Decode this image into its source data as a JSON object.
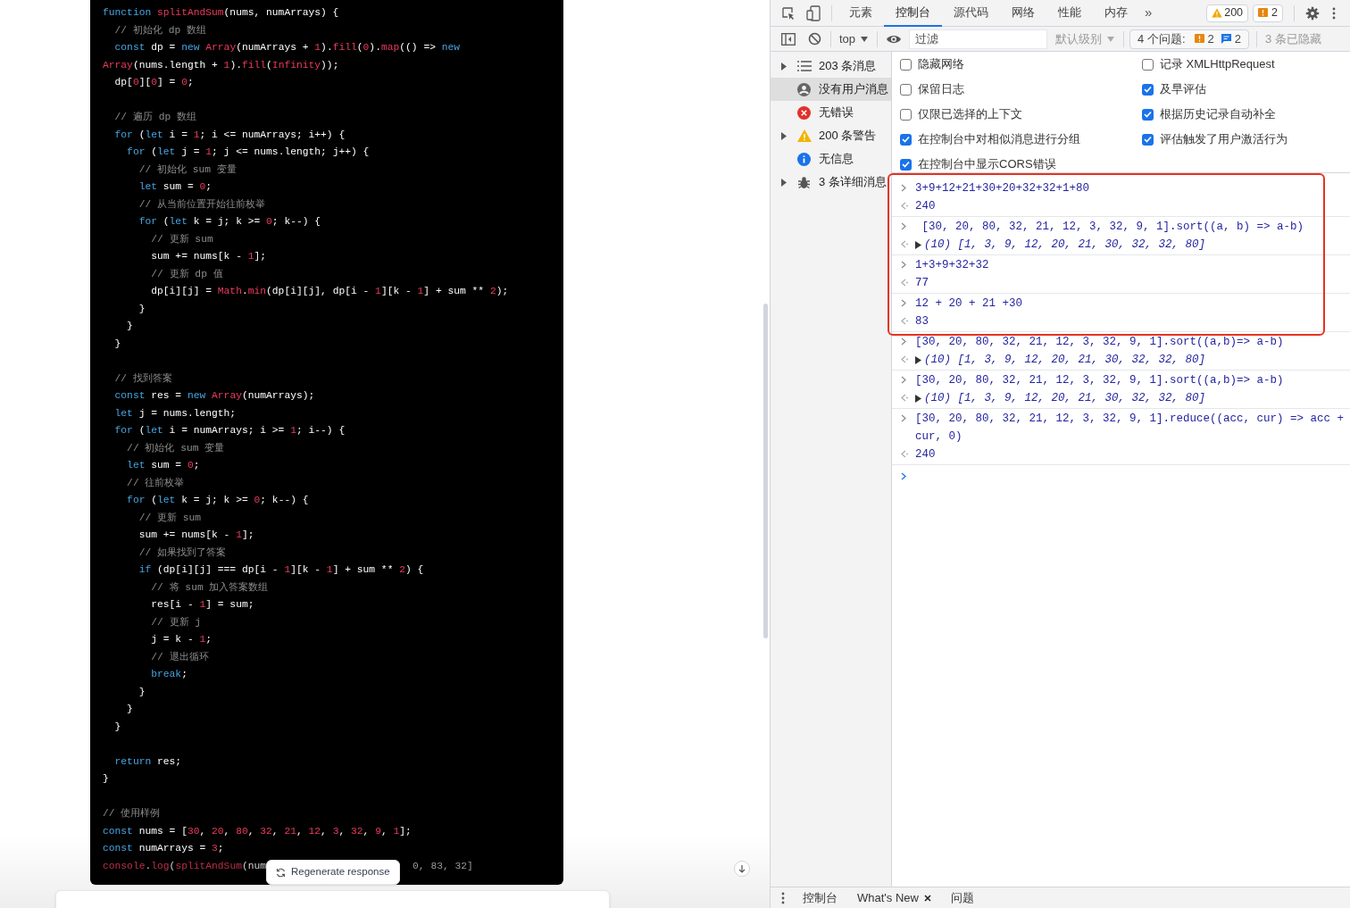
{
  "editor": {
    "paragraphs": [
      [
        [
          {
            "kind": "keyword",
            "text": "function "
          },
          {
            "kind": "name",
            "text": "splitAndSum"
          },
          {
            "kind": "plain",
            "text": "(nums, numArrays) {"
          }
        ],
        [
          {
            "kind": "comment",
            "text": "  // 初始化 dp 数组"
          }
        ],
        [
          {
            "kind": "keyword",
            "text": "  const"
          },
          {
            "kind": "plain",
            "text": " dp = "
          },
          {
            "kind": "keyword",
            "text": "new "
          },
          {
            "kind": "name",
            "text": "Array"
          },
          {
            "kind": "plain",
            "text": "(numArrays + "
          },
          {
            "kind": "name",
            "text": "1"
          },
          {
            "kind": "plain",
            "text": ")."
          },
          {
            "kind": "name",
            "text": "fill"
          },
          {
            "kind": "plain",
            "text": "("
          },
          {
            "kind": "name",
            "text": "0"
          },
          {
            "kind": "plain",
            "text": ")."
          },
          {
            "kind": "name",
            "text": "map"
          },
          {
            "kind": "plain",
            "text": "(() => "
          },
          {
            "kind": "keyword",
            "text": "new"
          }
        ],
        [
          {
            "kind": "name",
            "text": "Array"
          },
          {
            "kind": "plain",
            "text": "(nums.length + "
          },
          {
            "kind": "name",
            "text": "1"
          },
          {
            "kind": "plain",
            "text": ")."
          },
          {
            "kind": "name",
            "text": "fill"
          },
          {
            "kind": "plain",
            "text": "("
          },
          {
            "kind": "name",
            "text": "Infinity"
          },
          {
            "kind": "plain",
            "text": "));"
          }
        ],
        [
          {
            "kind": "plain",
            "text": "  dp["
          },
          {
            "kind": "name",
            "text": "0"
          },
          {
            "kind": "plain",
            "text": "]["
          },
          {
            "kind": "name",
            "text": "0"
          },
          {
            "kind": "plain",
            "text": "] = "
          },
          {
            "kind": "name",
            "text": "0"
          },
          {
            "kind": "plain",
            "text": ";"
          }
        ]
      ],
      [
        [
          {
            "kind": "comment",
            "text": "  // 遍历 dp 数组"
          }
        ],
        [
          {
            "kind": "keyword",
            "text": "  for"
          },
          {
            "kind": "plain",
            "text": " ("
          },
          {
            "kind": "keyword",
            "text": "let"
          },
          {
            "kind": "plain",
            "text": " i = "
          },
          {
            "kind": "name",
            "text": "1"
          },
          {
            "kind": "plain",
            "text": "; i <= numArrays; i++) {"
          }
        ],
        [
          {
            "kind": "keyword",
            "text": "    for"
          },
          {
            "kind": "plain",
            "text": " ("
          },
          {
            "kind": "keyword",
            "text": "let"
          },
          {
            "kind": "plain",
            "text": " j = "
          },
          {
            "kind": "name",
            "text": "1"
          },
          {
            "kind": "plain",
            "text": "; j <= nums.length; j++) {"
          }
        ],
        [
          {
            "kind": "comment",
            "text": "      // 初始化 sum 变量"
          }
        ],
        [
          {
            "kind": "keyword",
            "text": "      let"
          },
          {
            "kind": "plain",
            "text": " sum = "
          },
          {
            "kind": "name",
            "text": "0"
          },
          {
            "kind": "plain",
            "text": ";"
          }
        ],
        [
          {
            "kind": "comment",
            "text": "      // 从当前位置开始往前枚举"
          }
        ],
        [
          {
            "kind": "keyword",
            "text": "      for"
          },
          {
            "kind": "plain",
            "text": " ("
          },
          {
            "kind": "keyword",
            "text": "let"
          },
          {
            "kind": "plain",
            "text": " k = j; k >= "
          },
          {
            "kind": "name",
            "text": "0"
          },
          {
            "kind": "plain",
            "text": "; k--) {"
          }
        ],
        [
          {
            "kind": "comment",
            "text": "        // 更新 sum"
          }
        ],
        [
          {
            "kind": "plain",
            "text": "        sum += nums[k - "
          },
          {
            "kind": "name",
            "text": "1"
          },
          {
            "kind": "plain",
            "text": "];"
          }
        ],
        [
          {
            "kind": "comment",
            "text": "        // 更新 dp 值"
          }
        ],
        [
          {
            "kind": "plain",
            "text": "        dp[i][j] = "
          },
          {
            "kind": "name",
            "text": "Math"
          },
          {
            "kind": "plain",
            "text": "."
          },
          {
            "kind": "name",
            "text": "min"
          },
          {
            "kind": "plain",
            "text": "(dp[i][j], dp[i - "
          },
          {
            "kind": "name",
            "text": "1"
          },
          {
            "kind": "plain",
            "text": "][k - "
          },
          {
            "kind": "name",
            "text": "1"
          },
          {
            "kind": "plain",
            "text": "] + sum ** "
          },
          {
            "kind": "name",
            "text": "2"
          },
          {
            "kind": "plain",
            "text": ");"
          }
        ],
        [
          {
            "kind": "plain",
            "text": "      }"
          }
        ],
        [
          {
            "kind": "plain",
            "text": "    }"
          }
        ],
        [
          {
            "kind": "plain",
            "text": "  }"
          }
        ]
      ],
      [
        [
          {
            "kind": "comment",
            "text": "  // 找到答案"
          }
        ],
        [
          {
            "kind": "keyword",
            "text": "  const"
          },
          {
            "kind": "plain",
            "text": " res = "
          },
          {
            "kind": "keyword",
            "text": "new "
          },
          {
            "kind": "name",
            "text": "Array"
          },
          {
            "kind": "plain",
            "text": "(numArrays);"
          }
        ],
        [
          {
            "kind": "keyword",
            "text": "  let"
          },
          {
            "kind": "plain",
            "text": " j = nums.length;"
          }
        ],
        [
          {
            "kind": "keyword",
            "text": "  for"
          },
          {
            "kind": "plain",
            "text": " ("
          },
          {
            "kind": "keyword",
            "text": "let"
          },
          {
            "kind": "plain",
            "text": " i = numArrays; i >= "
          },
          {
            "kind": "name",
            "text": "1"
          },
          {
            "kind": "plain",
            "text": "; i--) {"
          }
        ],
        [
          {
            "kind": "comment",
            "text": "    // 初始化 sum 变量"
          }
        ],
        [
          {
            "kind": "keyword",
            "text": "    let"
          },
          {
            "kind": "plain",
            "text": " sum = "
          },
          {
            "kind": "name",
            "text": "0"
          },
          {
            "kind": "plain",
            "text": ";"
          }
        ],
        [
          {
            "kind": "comment",
            "text": "    // 往前枚举"
          }
        ],
        [
          {
            "kind": "keyword",
            "text": "    for"
          },
          {
            "kind": "plain",
            "text": " ("
          },
          {
            "kind": "keyword",
            "text": "let"
          },
          {
            "kind": "plain",
            "text": " k = j; k >= "
          },
          {
            "kind": "name",
            "text": "0"
          },
          {
            "kind": "plain",
            "text": "; k--) {"
          }
        ],
        [
          {
            "kind": "comment",
            "text": "      // 更新 sum"
          }
        ],
        [
          {
            "kind": "plain",
            "text": "      sum += nums[k - "
          },
          {
            "kind": "name",
            "text": "1"
          },
          {
            "kind": "plain",
            "text": "];"
          }
        ],
        [
          {
            "kind": "comment",
            "text": "      // 如果找到了答案"
          }
        ],
        [
          {
            "kind": "keyword",
            "text": "      if"
          },
          {
            "kind": "plain",
            "text": " (dp[i][j] === dp[i - "
          },
          {
            "kind": "name",
            "text": "1"
          },
          {
            "kind": "plain",
            "text": "][k - "
          },
          {
            "kind": "name",
            "text": "1"
          },
          {
            "kind": "plain",
            "text": "] + sum ** "
          },
          {
            "kind": "name",
            "text": "2"
          },
          {
            "kind": "plain",
            "text": ") {"
          }
        ],
        [
          {
            "kind": "comment",
            "text": "        // 将 sum 加入答案数组"
          }
        ],
        [
          {
            "kind": "plain",
            "text": "        res[i - "
          },
          {
            "kind": "name",
            "text": "1"
          },
          {
            "kind": "plain",
            "text": "] = sum;"
          }
        ],
        [
          {
            "kind": "comment",
            "text": "        // 更新 j"
          }
        ],
        [
          {
            "kind": "plain",
            "text": "        j = k - "
          },
          {
            "kind": "name",
            "text": "1"
          },
          {
            "kind": "plain",
            "text": ";"
          }
        ],
        [
          {
            "kind": "comment",
            "text": "        // 退出循环"
          }
        ],
        [
          {
            "kind": "keyword",
            "text": "        break"
          },
          {
            "kind": "plain",
            "text": ";"
          }
        ],
        [
          {
            "kind": "plain",
            "text": "      }"
          }
        ],
        [
          {
            "kind": "plain",
            "text": "    }"
          }
        ],
        [
          {
            "kind": "plain",
            "text": "  }"
          }
        ]
      ],
      [
        [
          {
            "kind": "keyword",
            "text": "  return"
          },
          {
            "kind": "plain",
            "text": " res;"
          }
        ],
        [
          {
            "kind": "plain",
            "text": "}"
          }
        ]
      ],
      [
        [
          {
            "kind": "comment",
            "text": "// 使用样例"
          }
        ],
        [
          {
            "kind": "keyword",
            "text": "const"
          },
          {
            "kind": "plain",
            "text": " nums = ["
          },
          {
            "kind": "name",
            "text": "30"
          },
          {
            "kind": "plain",
            "text": ", "
          },
          {
            "kind": "name",
            "text": "20"
          },
          {
            "kind": "plain",
            "text": ", "
          },
          {
            "kind": "name",
            "text": "80"
          },
          {
            "kind": "plain",
            "text": ", "
          },
          {
            "kind": "name",
            "text": "32"
          },
          {
            "kind": "plain",
            "text": ", "
          },
          {
            "kind": "name",
            "text": "21"
          },
          {
            "kind": "plain",
            "text": ", "
          },
          {
            "kind": "name",
            "text": "12"
          },
          {
            "kind": "plain",
            "text": ", "
          },
          {
            "kind": "name",
            "text": "3"
          },
          {
            "kind": "plain",
            "text": ", "
          },
          {
            "kind": "name",
            "text": "32"
          },
          {
            "kind": "plain",
            "text": ", "
          },
          {
            "kind": "name",
            "text": "9"
          },
          {
            "kind": "plain",
            "text": ", "
          },
          {
            "kind": "name",
            "text": "1"
          },
          {
            "kind": "plain",
            "text": "];"
          }
        ],
        [
          {
            "kind": "keyword",
            "text": "const"
          },
          {
            "kind": "plain",
            "text": " numArrays = "
          },
          {
            "kind": "name",
            "text": "3"
          },
          {
            "kind": "plain",
            "text": ";"
          }
        ]
      ]
    ],
    "last_line_left": [
      {
        "kind": "name",
        "text": "console"
      },
      {
        "kind": "plain",
        "text": "."
      },
      {
        "kind": "name",
        "text": "log"
      },
      {
        "kind": "plain",
        "text": "("
      },
      {
        "kind": "name",
        "text": "splitAndSum"
      },
      {
        "kind": "plain",
        "text": "(num"
      }
    ],
    "last_line_right": "0, 83, 32]",
    "regenerate_button": "Regenerate response"
  },
  "devtools": {
    "tabs": [
      {
        "label": "元素",
        "selected": false
      },
      {
        "label": "控制台",
        "selected": true
      },
      {
        "label": "源代码",
        "selected": false
      },
      {
        "label": "网络",
        "selected": false
      },
      {
        "label": "性能",
        "selected": false
      },
      {
        "label": "内存",
        "selected": false
      }
    ],
    "overflow": "»",
    "warning_badge": "200",
    "issue_badge": "2",
    "toolbar": {
      "context": "top",
      "filter_placeholder": "过滤",
      "levels": "默认级别",
      "issues_label": "4 个问题:",
      "issue_warnings": "2",
      "issue_infos": "2",
      "hidden": "3 条已隐藏"
    },
    "sidebar": [
      {
        "label": "203 条消息",
        "kind": "list",
        "expandable": true,
        "selected": false
      },
      {
        "label": "没有用户消息",
        "kind": "user",
        "expandable": false,
        "selected": true
      },
      {
        "label": "无错误",
        "kind": "error",
        "expandable": false,
        "selected": false
      },
      {
        "label": "200 条警告",
        "kind": "warning",
        "expandable": true,
        "selected": false
      },
      {
        "label": "无信息",
        "kind": "info",
        "expandable": false,
        "selected": false
      },
      {
        "label": "3 条详细消息",
        "kind": "verbose",
        "expandable": true,
        "selected": false
      }
    ],
    "settings_columns": [
      [
        {
          "label": "隐藏网络",
          "checked": false
        },
        {
          "label": "保留日志",
          "checked": false
        },
        {
          "label": "仅限已选择的上下文",
          "checked": false
        },
        {
          "label": "在控制台中对相似消息进行分组",
          "checked": true
        },
        {
          "label": "在控制台中显示CORS错误",
          "checked": true
        }
      ],
      [
        {
          "label": "记录 XMLHttpRequest",
          "checked": false
        },
        {
          "label": "及早评估",
          "checked": true
        },
        {
          "label": "根据历史记录自动补全",
          "checked": true
        },
        {
          "label": "评估触发了用户激活行为",
          "checked": true
        }
      ]
    ],
    "console": [
      {
        "kind": "value",
        "input": "3+9+12+21+30+20+32+32+1+80",
        "output": "240"
      },
      {
        "kind": "array",
        "input": " [30, 20, 80, 32, 21, 12, 3, 32, 9, 1].sort((a, b) => a-b)",
        "output": "(10) [1, 3, 9, 12, 20, 21, 30, 32, 32, 80]"
      },
      {
        "kind": "value",
        "input": "1+3+9+32+32",
        "output": "77"
      },
      {
        "kind": "value",
        "input": "12 + 20 + 21 +30",
        "output": "83"
      },
      {
        "kind": "array",
        "input": "[30, 20, 80, 32, 21, 12, 3, 32, 9, 1].sort((a,b)=> a-b)",
        "output": "(10) [1, 3, 9, 12, 20, 21, 30, 32, 32, 80]"
      },
      {
        "kind": "array",
        "input": "[30, 20, 80, 32, 21, 12, 3, 32, 9, 1].sort((a,b)=> a-b)",
        "output": "(10) [1, 3, 9, 12, 20, 21, 30, 32, 32, 80]"
      },
      {
        "kind": "value",
        "input": "[30, 20, 80, 32, 21, 12, 3, 32, 9, 1].reduce((acc, cur) => acc + cur, 0)",
        "output": "240"
      }
    ],
    "drawer_tabs": [
      {
        "label": "控制台",
        "closable": false
      },
      {
        "label": "What's New",
        "closable": true
      },
      {
        "label": "问题",
        "closable": false
      }
    ]
  }
}
